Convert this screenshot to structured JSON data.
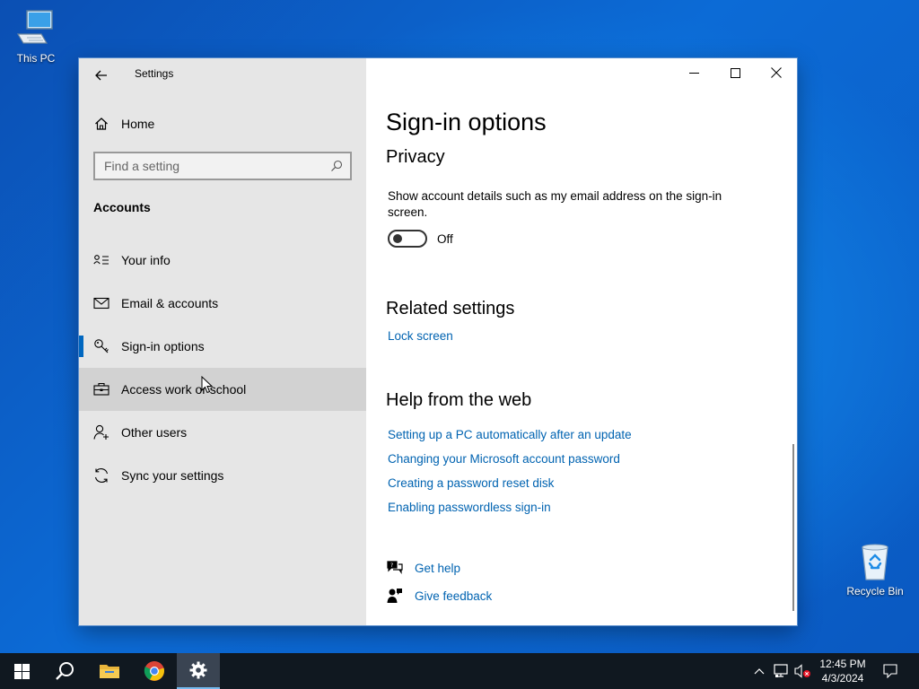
{
  "desktop": {
    "icons": [
      {
        "label": "This PC"
      },
      {
        "label": "Recycle Bin"
      }
    ]
  },
  "window": {
    "app_title": "Settings",
    "controls": {
      "minimize": "minimize-icon",
      "maximize": "maximize-icon",
      "close": "close-icon"
    }
  },
  "sidebar": {
    "home_label": "Home",
    "search_placeholder": "Find a setting",
    "section_heading": "Accounts",
    "items": [
      {
        "label": "Your info",
        "icon": "contact-card-icon"
      },
      {
        "label": "Email & accounts",
        "icon": "mail-icon"
      },
      {
        "label": "Sign-in options",
        "icon": "key-icon",
        "selected": true
      },
      {
        "label": "Access work or school",
        "icon": "briefcase-icon",
        "hover": true
      },
      {
        "label": "Other users",
        "icon": "person-add-icon"
      },
      {
        "label": "Sync your settings",
        "icon": "sync-icon"
      }
    ]
  },
  "main": {
    "page_title": "Sign-in options",
    "privacy": {
      "title": "Privacy",
      "description": "Show account details such as my email address on the sign-in screen.",
      "toggle_state": "Off"
    },
    "related": {
      "title": "Related settings",
      "links": [
        "Lock screen"
      ]
    },
    "help": {
      "title": "Help from the web",
      "links": [
        "Setting up a PC automatically after an update",
        "Changing your Microsoft account password",
        "Creating a password reset disk",
        "Enabling passwordless sign-in"
      ],
      "get_help": "Get help",
      "give_feedback": "Give feedback"
    }
  },
  "taskbar": {
    "time": "12:45 PM",
    "date": "4/3/2024",
    "accent": "#76b9ed"
  },
  "colors": {
    "link": "#0063b1",
    "selection_bar": "#0067c0",
    "sidebar_bg": "#e6e6e6"
  }
}
